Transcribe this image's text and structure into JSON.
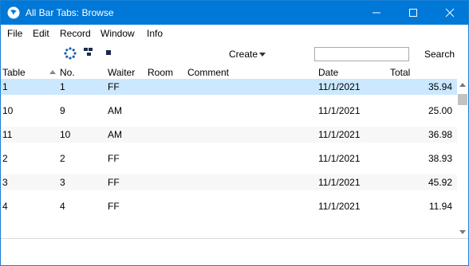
{
  "window": {
    "title": "All Bar Tabs: Browse",
    "accent": "#0078d7",
    "selected_row_color": "#cce8ff",
    "stripe_color": "#f7f7f7"
  },
  "menu": [
    "File",
    "Edit",
    "Record",
    "Window",
    "Info"
  ],
  "toolbar": {
    "icons": [
      "circle-arrows-icon",
      "cascade-windows-icon",
      "stop-square-icon"
    ],
    "create_label": "Create",
    "search_value": "",
    "search_label": "Search"
  },
  "columns": {
    "table": "Table",
    "no": "No.",
    "waiter": "Waiter",
    "room": "Room",
    "comment": "Comment",
    "date": "Date",
    "total": "Total"
  },
  "sort": {
    "column": "Table",
    "direction": "ascending"
  },
  "rows": [
    {
      "table": "1",
      "no": "1",
      "waiter": "FF",
      "room": "",
      "comment": "",
      "date": "11/1/2021",
      "total": "35.94",
      "selected": true
    },
    {
      "table": "10",
      "no": "9",
      "waiter": "AM",
      "room": "",
      "comment": "",
      "date": "11/1/2021",
      "total": "25.00",
      "selected": false
    },
    {
      "table": "11",
      "no": "10",
      "waiter": "AM",
      "room": "",
      "comment": "",
      "date": "11/1/2021",
      "total": "36.98",
      "selected": false
    },
    {
      "table": "2",
      "no": "2",
      "waiter": "FF",
      "room": "",
      "comment": "",
      "date": "11/1/2021",
      "total": "38.93",
      "selected": false
    },
    {
      "table": "3",
      "no": "3",
      "waiter": "FF",
      "room": "",
      "comment": "",
      "date": "11/1/2021",
      "total": "45.92",
      "selected": false
    },
    {
      "table": "4",
      "no": "4",
      "waiter": "FF",
      "room": "",
      "comment": "",
      "date": "11/1/2021",
      "total": "11.94",
      "selected": false
    }
  ]
}
